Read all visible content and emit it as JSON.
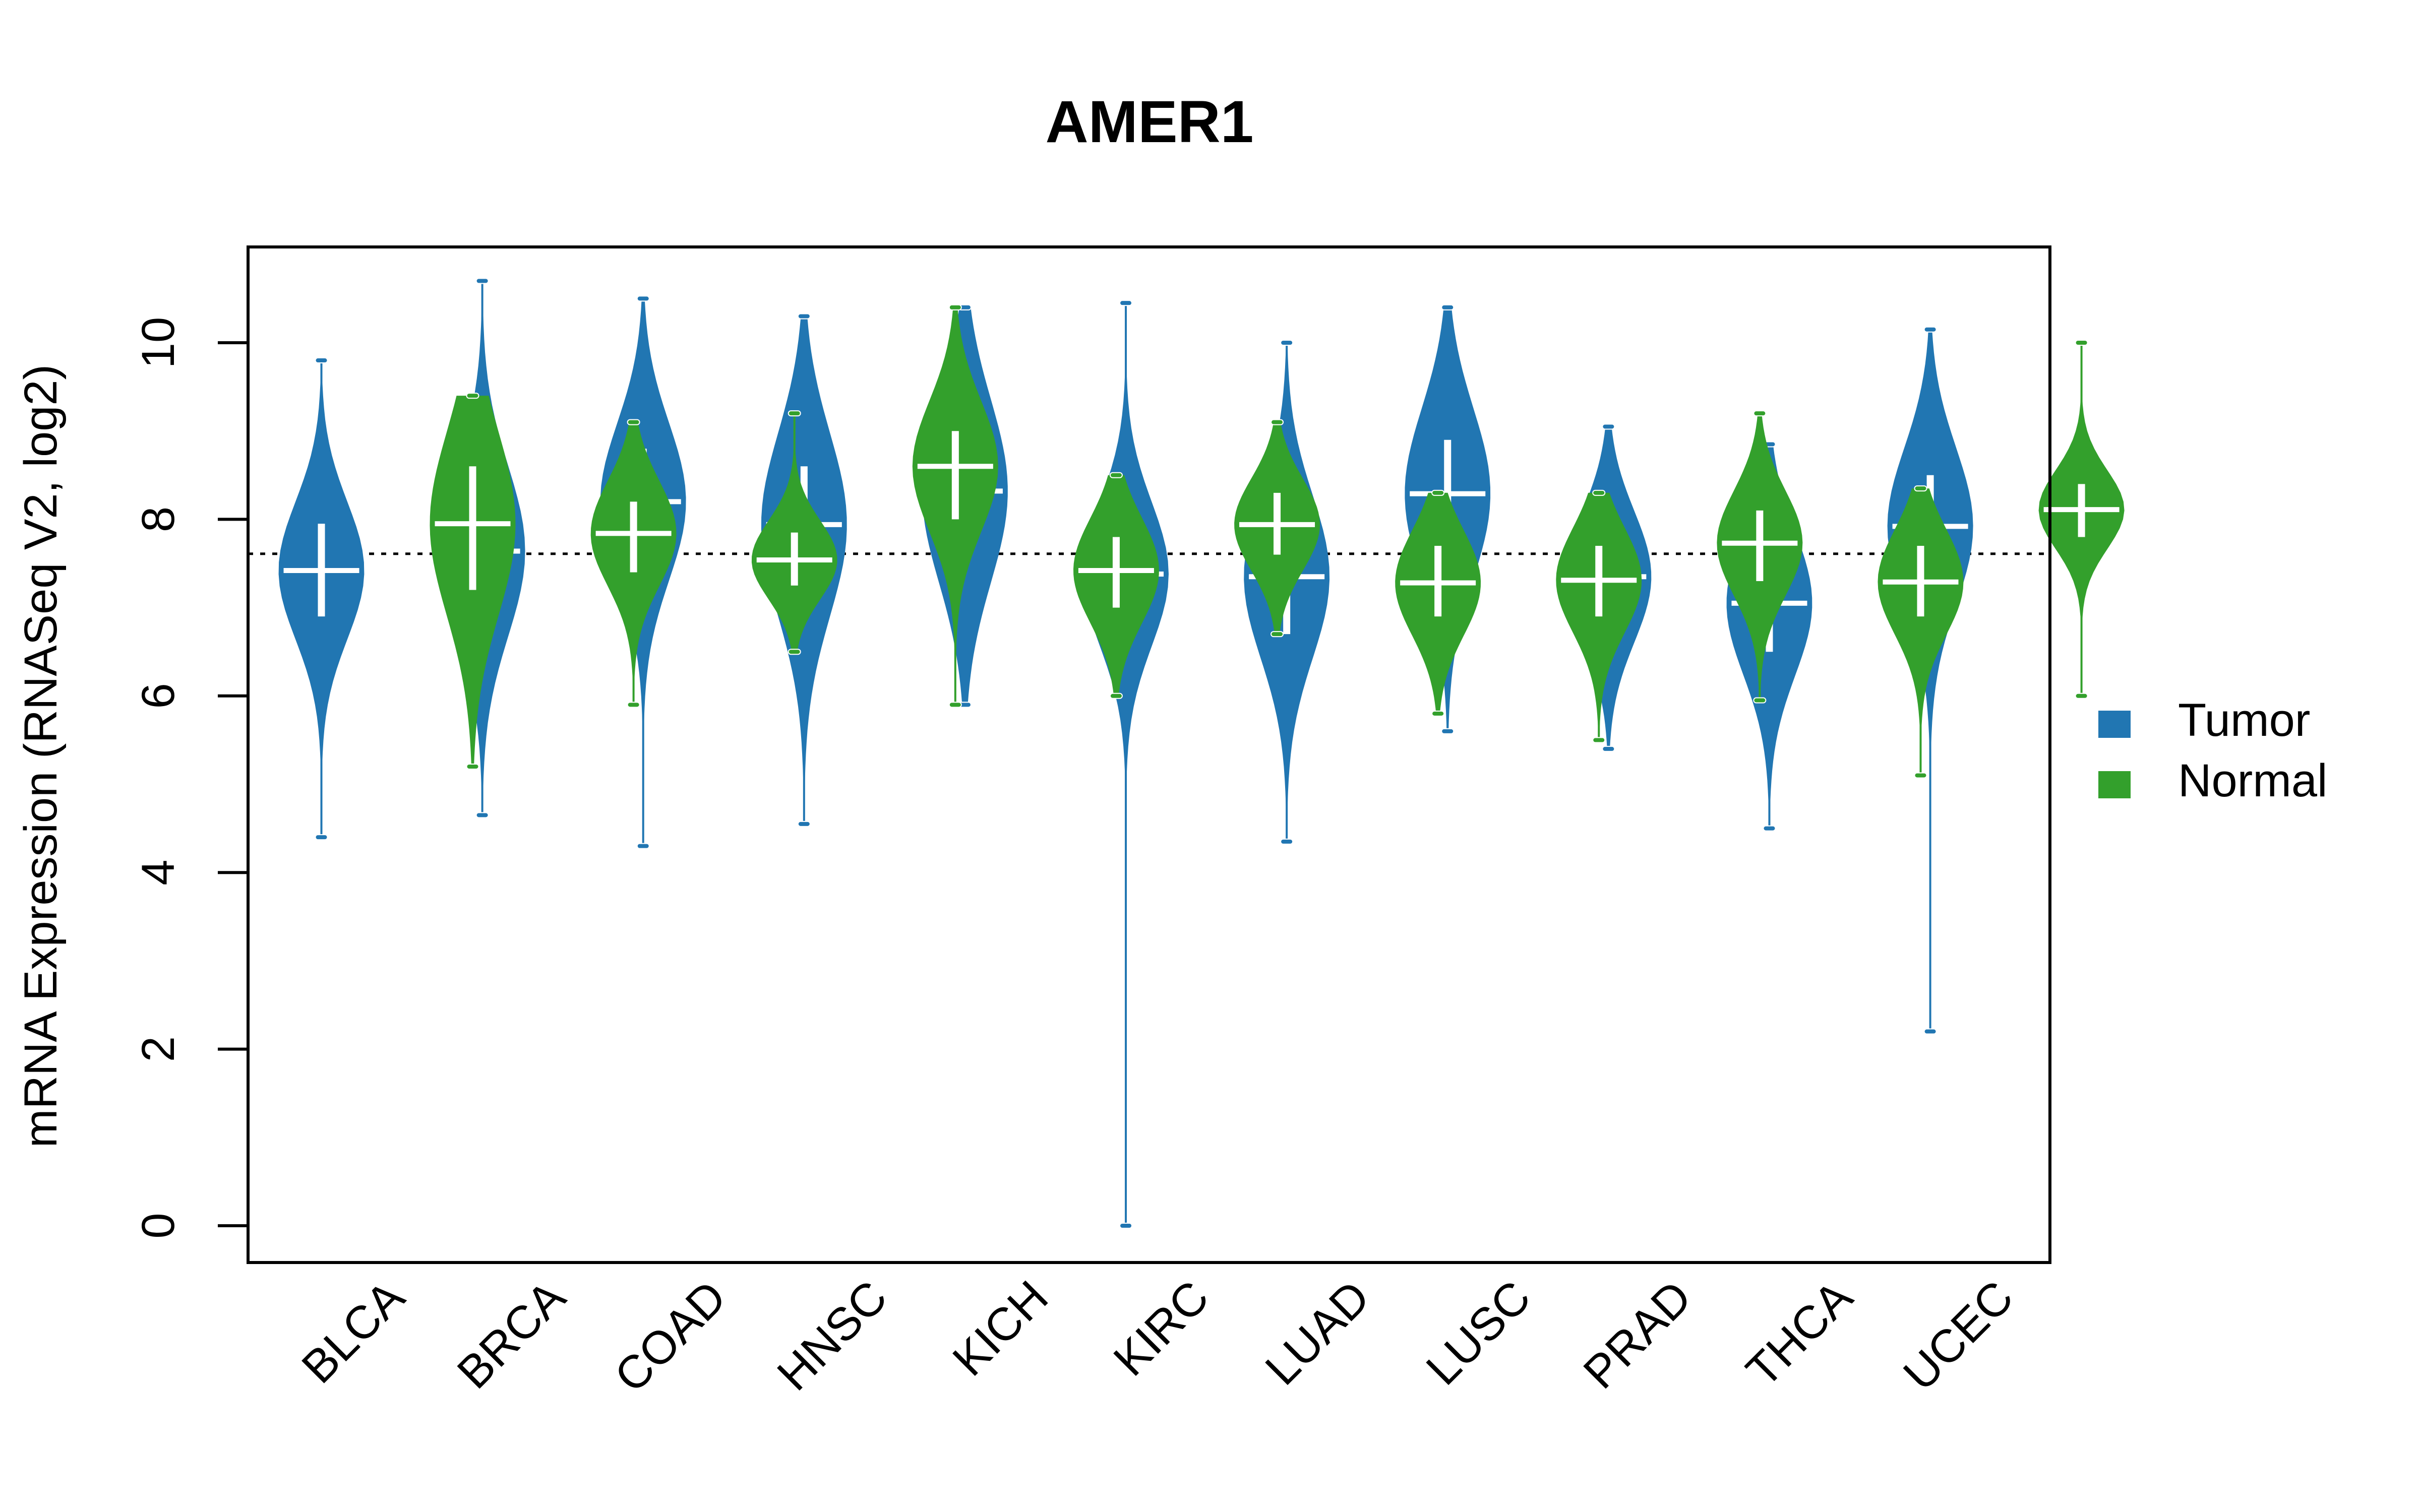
{
  "chart_data": {
    "type": "violin",
    "title": "AMER1",
    "xlabel": "",
    "ylabel": "mRNA Expression (RNASeq V2, log2)",
    "ylim": [
      -0.4,
      11.1
    ],
    "yticks": [
      0,
      2,
      4,
      6,
      8,
      10
    ],
    "reference_line": 7.61,
    "legend": {
      "position": "right",
      "entries": [
        {
          "name": "Tumor",
          "color": "#2176b2"
        },
        {
          "name": "Normal",
          "color": "#33a02c"
        }
      ]
    },
    "categories": [
      "BLCA",
      "BRCA",
      "COAD",
      "HNSC",
      "KICH",
      "KIRC",
      "LUAD",
      "LUSC",
      "PRAD",
      "THCA",
      "UCEC"
    ],
    "series": [
      {
        "name": "Tumor",
        "color": "#2176b2",
        "median": [
          7.42,
          7.64,
          8.2,
          7.94,
          8.32,
          7.38,
          7.35,
          8.29,
          7.35,
          7.05,
          7.92
        ],
        "q1": [
          6.9,
          7.0,
          7.6,
          7.2,
          7.6,
          6.8,
          6.7,
          7.6,
          6.9,
          6.5,
          7.3
        ],
        "q3": [
          7.95,
          8.3,
          8.8,
          8.6,
          9.0,
          7.9,
          7.95,
          8.9,
          7.9,
          7.6,
          8.5
        ],
        "min": [
          4.4,
          4.65,
          4.3,
          4.55,
          5.9,
          0.0,
          4.35,
          5.6,
          5.4,
          4.5,
          2.2
        ],
        "max": [
          9.8,
          10.7,
          10.5,
          10.3,
          10.4,
          10.45,
          10.0,
          10.4,
          9.05,
          8.85,
          10.15
        ]
      },
      {
        "name": "Normal",
        "color": "#33a02c",
        "median": [
          7.95,
          7.84,
          7.54,
          8.6,
          7.42,
          7.94,
          7.28,
          7.31,
          7.73,
          7.29,
          8.11
        ],
        "q1": [
          7.2,
          7.4,
          7.25,
          8.0,
          7.0,
          7.6,
          6.9,
          6.9,
          7.3,
          6.9,
          7.8
        ],
        "q3": [
          8.6,
          8.2,
          7.85,
          9.0,
          7.8,
          8.3,
          7.7,
          7.7,
          8.1,
          7.7,
          8.4
        ],
        "min": [
          5.2,
          5.9,
          6.5,
          5.9,
          6.0,
          6.7,
          5.8,
          5.5,
          5.95,
          5.1,
          6.0
        ],
        "max": [
          9.4,
          9.1,
          9.2,
          10.4,
          8.5,
          9.1,
          8.3,
          8.3,
          9.2,
          8.35,
          10.0
        ]
      }
    ]
  }
}
